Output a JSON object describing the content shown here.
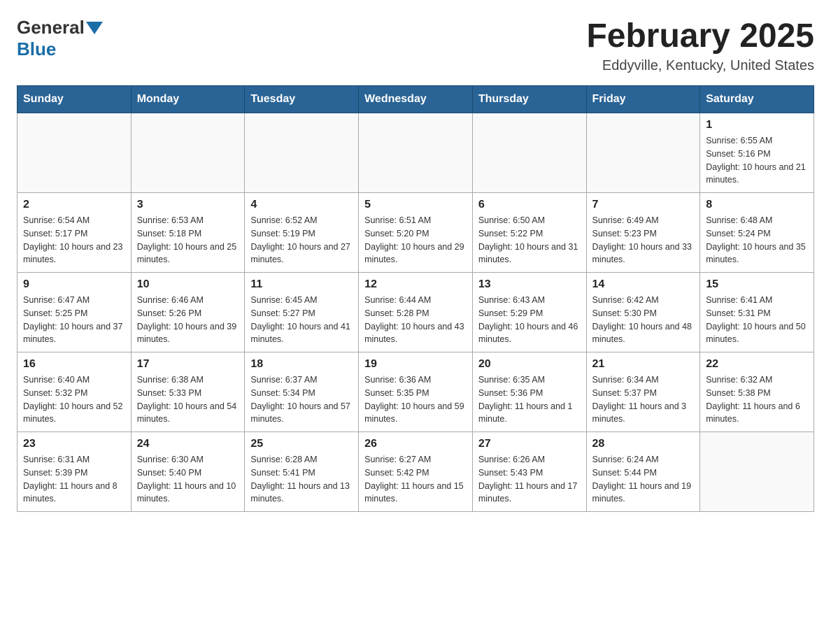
{
  "logo": {
    "general": "General",
    "blue": "Blue"
  },
  "header": {
    "title": "February 2025",
    "subtitle": "Eddyville, Kentucky, United States"
  },
  "weekdays": [
    "Sunday",
    "Monday",
    "Tuesday",
    "Wednesday",
    "Thursday",
    "Friday",
    "Saturday"
  ],
  "weeks": [
    [
      {
        "day": "",
        "info": ""
      },
      {
        "day": "",
        "info": ""
      },
      {
        "day": "",
        "info": ""
      },
      {
        "day": "",
        "info": ""
      },
      {
        "day": "",
        "info": ""
      },
      {
        "day": "",
        "info": ""
      },
      {
        "day": "1",
        "info": "Sunrise: 6:55 AM\nSunset: 5:16 PM\nDaylight: 10 hours and 21 minutes."
      }
    ],
    [
      {
        "day": "2",
        "info": "Sunrise: 6:54 AM\nSunset: 5:17 PM\nDaylight: 10 hours and 23 minutes."
      },
      {
        "day": "3",
        "info": "Sunrise: 6:53 AM\nSunset: 5:18 PM\nDaylight: 10 hours and 25 minutes."
      },
      {
        "day": "4",
        "info": "Sunrise: 6:52 AM\nSunset: 5:19 PM\nDaylight: 10 hours and 27 minutes."
      },
      {
        "day": "5",
        "info": "Sunrise: 6:51 AM\nSunset: 5:20 PM\nDaylight: 10 hours and 29 minutes."
      },
      {
        "day": "6",
        "info": "Sunrise: 6:50 AM\nSunset: 5:22 PM\nDaylight: 10 hours and 31 minutes."
      },
      {
        "day": "7",
        "info": "Sunrise: 6:49 AM\nSunset: 5:23 PM\nDaylight: 10 hours and 33 minutes."
      },
      {
        "day": "8",
        "info": "Sunrise: 6:48 AM\nSunset: 5:24 PM\nDaylight: 10 hours and 35 minutes."
      }
    ],
    [
      {
        "day": "9",
        "info": "Sunrise: 6:47 AM\nSunset: 5:25 PM\nDaylight: 10 hours and 37 minutes."
      },
      {
        "day": "10",
        "info": "Sunrise: 6:46 AM\nSunset: 5:26 PM\nDaylight: 10 hours and 39 minutes."
      },
      {
        "day": "11",
        "info": "Sunrise: 6:45 AM\nSunset: 5:27 PM\nDaylight: 10 hours and 41 minutes."
      },
      {
        "day": "12",
        "info": "Sunrise: 6:44 AM\nSunset: 5:28 PM\nDaylight: 10 hours and 43 minutes."
      },
      {
        "day": "13",
        "info": "Sunrise: 6:43 AM\nSunset: 5:29 PM\nDaylight: 10 hours and 46 minutes."
      },
      {
        "day": "14",
        "info": "Sunrise: 6:42 AM\nSunset: 5:30 PM\nDaylight: 10 hours and 48 minutes."
      },
      {
        "day": "15",
        "info": "Sunrise: 6:41 AM\nSunset: 5:31 PM\nDaylight: 10 hours and 50 minutes."
      }
    ],
    [
      {
        "day": "16",
        "info": "Sunrise: 6:40 AM\nSunset: 5:32 PM\nDaylight: 10 hours and 52 minutes."
      },
      {
        "day": "17",
        "info": "Sunrise: 6:38 AM\nSunset: 5:33 PM\nDaylight: 10 hours and 54 minutes."
      },
      {
        "day": "18",
        "info": "Sunrise: 6:37 AM\nSunset: 5:34 PM\nDaylight: 10 hours and 57 minutes."
      },
      {
        "day": "19",
        "info": "Sunrise: 6:36 AM\nSunset: 5:35 PM\nDaylight: 10 hours and 59 minutes."
      },
      {
        "day": "20",
        "info": "Sunrise: 6:35 AM\nSunset: 5:36 PM\nDaylight: 11 hours and 1 minute."
      },
      {
        "day": "21",
        "info": "Sunrise: 6:34 AM\nSunset: 5:37 PM\nDaylight: 11 hours and 3 minutes."
      },
      {
        "day": "22",
        "info": "Sunrise: 6:32 AM\nSunset: 5:38 PM\nDaylight: 11 hours and 6 minutes."
      }
    ],
    [
      {
        "day": "23",
        "info": "Sunrise: 6:31 AM\nSunset: 5:39 PM\nDaylight: 11 hours and 8 minutes."
      },
      {
        "day": "24",
        "info": "Sunrise: 6:30 AM\nSunset: 5:40 PM\nDaylight: 11 hours and 10 minutes."
      },
      {
        "day": "25",
        "info": "Sunrise: 6:28 AM\nSunset: 5:41 PM\nDaylight: 11 hours and 13 minutes."
      },
      {
        "day": "26",
        "info": "Sunrise: 6:27 AM\nSunset: 5:42 PM\nDaylight: 11 hours and 15 minutes."
      },
      {
        "day": "27",
        "info": "Sunrise: 6:26 AM\nSunset: 5:43 PM\nDaylight: 11 hours and 17 minutes."
      },
      {
        "day": "28",
        "info": "Sunrise: 6:24 AM\nSunset: 5:44 PM\nDaylight: 11 hours and 19 minutes."
      },
      {
        "day": "",
        "info": ""
      }
    ]
  ]
}
